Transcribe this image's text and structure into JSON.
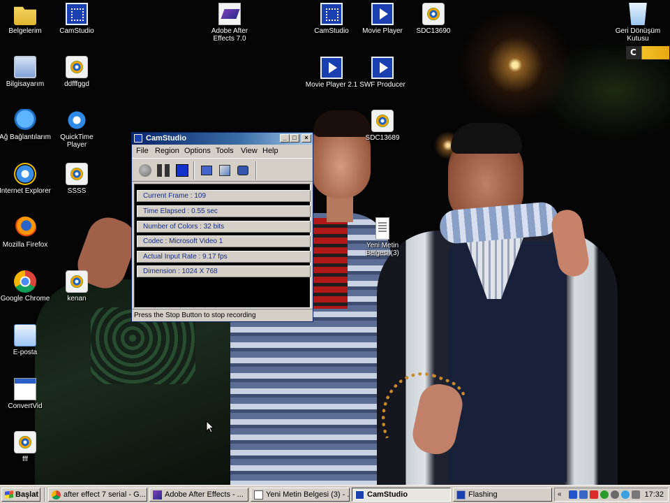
{
  "desktop": {
    "icons_left": [
      {
        "label": "Belgelerim",
        "icon": "my-documents-icon"
      },
      {
        "label": "Bilgisayarım",
        "icon": "my-computer-icon"
      },
      {
        "label": "Ağ Bağlantılarım",
        "icon": "network-icon"
      },
      {
        "label": "Internet Explorer",
        "icon": "internet-explorer-icon"
      },
      {
        "label": "Mozilla Firefox",
        "icon": "firefox-icon"
      },
      {
        "label": "Google Chrome",
        "icon": "chrome-icon"
      },
      {
        "label": "E-posta",
        "icon": "email-icon"
      },
      {
        "label": "ConvertVid",
        "icon": "app-window-icon"
      },
      {
        "label": "fff",
        "icon": "media-file-icon"
      }
    ],
    "icons_col2": [
      {
        "label": "CamStudio",
        "icon": "camstudio-icon"
      },
      {
        "label": "ddfffggd",
        "icon": "media-file-icon"
      },
      {
        "label": "QuickTime Player",
        "icon": "quicktime-icon"
      },
      {
        "label": "SSSS",
        "icon": "media-file-icon"
      },
      {
        "label": "kenan",
        "icon": "media-file-icon"
      }
    ],
    "icons_top": [
      {
        "label": "Adobe After Effects 7.0",
        "icon": "after-effects-icon"
      },
      {
        "label": "CamStudio",
        "icon": "camstudio-icon"
      },
      {
        "label": "Movie Player",
        "icon": "movie-player-icon"
      },
      {
        "label": "SDC13690",
        "icon": "media-file-icon"
      },
      {
        "label": "Movie Player 2.1",
        "icon": "movie-player-icon"
      },
      {
        "label": "SWF Producer",
        "icon": "movie-player-icon"
      },
      {
        "label": "SDC13689",
        "icon": "media-file-icon"
      },
      {
        "label": "Yeni Metin Belgesi (3)",
        "icon": "text-document-icon"
      }
    ],
    "recycle_bin": {
      "label": "Geri Dönüşüm Kutusu",
      "icon": "recycle-bin-icon"
    },
    "corner_badge": "C"
  },
  "camstudio": {
    "title": "CamStudio",
    "menu": [
      "File",
      "Region",
      "Options",
      "Tools",
      "View",
      "Help"
    ],
    "stats": [
      "Current Frame : 109",
      "Time Elapsed : 0.55 sec",
      "Number of Colors : 32 bits",
      "Codec : Microsoft Video 1",
      "Actual Input Rate : 9.17 fps",
      "Dimension : 1024 X 768"
    ],
    "status": "Press the Stop Button to stop recording",
    "titlebar_buttons": {
      "min": "_",
      "max": "□",
      "close": "×"
    }
  },
  "taskbar": {
    "start_label": "Başlat",
    "tasks": [
      {
        "label": "after effect 7 serial - G...",
        "icon": "chrome-icon",
        "active": false
      },
      {
        "label": "Adobe After Effects - ...",
        "icon": "after-effects-icon",
        "active": false
      },
      {
        "label": "Yeni Metin Belgesi (3) - ...",
        "icon": "notepad-icon",
        "active": false
      },
      {
        "label": "CamStudio",
        "icon": "camstudio-icon",
        "active": true
      },
      {
        "label": "Flashing",
        "icon": "flashing-icon",
        "active": false
      }
    ],
    "clock": "17:32"
  }
}
